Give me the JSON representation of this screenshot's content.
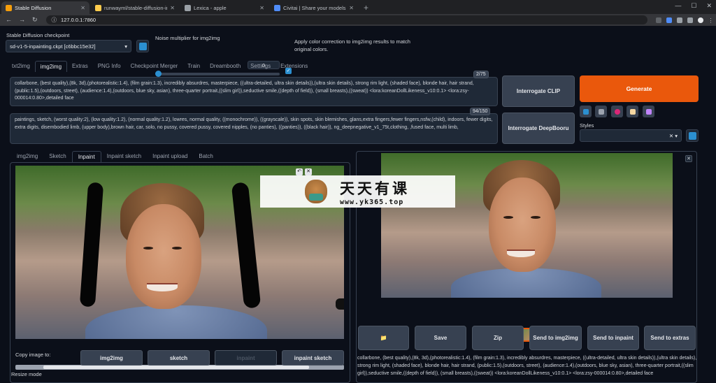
{
  "browser": {
    "tabs": [
      {
        "title": "Stable Diffusion",
        "color": "#f59e0b"
      },
      {
        "title": "runwayml/stable-diffusion-inpai",
        "color": "#ffcc4d"
      },
      {
        "title": "Lexica - apple",
        "color": "#9aa0a6"
      },
      {
        "title": "Civitai | Share your models",
        "color": "#4f8cf7"
      }
    ],
    "url": "127.0.0.1:7860"
  },
  "checkpoint": {
    "label": "Stable Diffusion checkpoint",
    "value": "sd-v1-5-inpainting.ckpt [c6bbc15e32]"
  },
  "noise": {
    "label": "Noise multiplier for img2img",
    "value": "0",
    "fraction": 0.0
  },
  "color_correction": {
    "label_line1": "Apply color correction to img2img results to match",
    "label_line2": "original colors.",
    "checked": true
  },
  "main_tabs": [
    "txt2img",
    "img2img",
    "Extras",
    "PNG Info",
    "Checkpoint Merger",
    "Train",
    "Dreambooth",
    "Settings",
    "Extensions"
  ],
  "prompt": {
    "text": "collarbone, (best quality),(8k, 3d),(photorealistic:1.4), (film grain:1.3), incredibly absurdres, masterpiece, ((ultra-detailed, ultra skin details)),(ultra skin details), strong rim light, (shaded face), blonde hair, hair strand, (public:1.5),(outdoors, street), (audience:1.4),(outdoors, blue sky, asian), three-quarter portrait,((slim girl)),seductive smile,((depth of field)), (small breasts),((sweat)) <lora:koreanDollLikeness_v10:0.1> <lora:zsy-000014:0.80>,detailed face",
    "counter": "2/75"
  },
  "negative": {
    "text": "paintings, sketch, (worst quality:2), (low quality:1.2), (normal quality:1.2), lowres, normal quality, ((monochrome)), ((grayscale)), skin spots, skin blemishes, glans,extra fingers,fewer fingers,nsfw,(child), indoors, fewer digits, extra digits, disembodied limb, (upper body),brown hair, car, solo, no pussy, covered pussy, covered nipples, (no panties), ((panties)), ((black hair)), ng_deepnegative_v1_75t,clothing, ,fused face, multi limb,",
    "counter": "94/150"
  },
  "buttons": {
    "interrogate_clip": "Interrogate CLIP",
    "interrogate_deepbooru": "Interrogate DeepBooru",
    "generate": "Generate"
  },
  "styles_label": "Styles",
  "sub_tabs": [
    "img2img",
    "Sketch",
    "Inpaint",
    "Inpaint sketch",
    "Inpaint upload",
    "Batch"
  ],
  "copy": {
    "label": "Copy image to:",
    "buttons": [
      "img2img",
      "sketch",
      "inpaint",
      "inpaint sketch"
    ]
  },
  "resize_mode": "Resize mode",
  "output_buttons": [
    {
      "label": "📁"
    },
    {
      "label": "Save"
    },
    {
      "label": "Zip"
    },
    {
      "label": "Send to img2img"
    },
    {
      "label": "Send to inpaint"
    },
    {
      "label": "Send to extras"
    }
  ],
  "output_text": "collarbone, (best quality),(8k, 3d),(photorealistic:1.4), (film grain:1.3), incredibly absurdres, masterpiece, ((ultra-detailed, ultra skin details)),(ultra skin details), strong rim light, (shaded face), blonde hair, hair strand, (public:1.5),(outdoors, street), (audience:1.4),(outdoors, blue sky, asian), three-quarter portrait,((slim girl)),seductive smile,((depth of field)), (small breasts),((sweat)) <lora:koreanDollLikeness_v10:0.1> <lora:zsy-000014:0.80>,detailed face",
  "watermark": {
    "title": "天天有课",
    "url": "www.yk365.top"
  },
  "colors": {
    "accent": "#ea580c",
    "blue": "#2b8fd0"
  }
}
